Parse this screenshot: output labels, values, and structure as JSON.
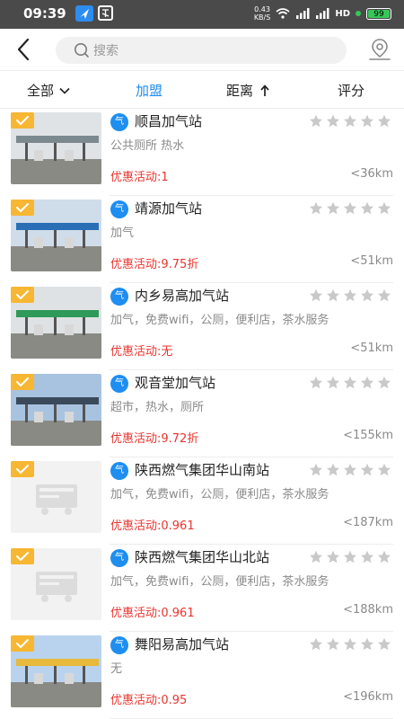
{
  "status_bar": {
    "time": "09:39",
    "net_speed_value": "0.43",
    "net_speed_unit": "KB/S",
    "hd_label": "HD",
    "battery": "99"
  },
  "header": {
    "search_placeholder": "搜索",
    "back_icon": "chevron-left-icon",
    "map_icon": "map-pin-icon"
  },
  "filters": {
    "all": "全部",
    "join": "加盟",
    "distance": "距离",
    "rating": "评分"
  },
  "colors": {
    "accent": "#1e8ef0",
    "promo": "#e8352f",
    "badge": "#f7b733"
  },
  "stations": [
    {
      "name": "顺昌加气站",
      "services": "公共厕所 热水",
      "promo": "优惠活动:1",
      "distance": "<36km",
      "gas_badge": "气",
      "image": "photo"
    },
    {
      "name": "靖源加气站",
      "services": "加气",
      "promo": "优惠活动:9.75折",
      "distance": "<51km",
      "gas_badge": "气",
      "image": "photo"
    },
    {
      "name": "内乡易高加气站",
      "services": "加气，免费wifi，公厕，便利店，茶水服务",
      "promo": "优惠活动:无",
      "distance": "<51km",
      "gas_badge": "气",
      "image": "photo"
    },
    {
      "name": "观音堂加气站",
      "services": "超市，热水，厕所",
      "promo": "优惠活动:9.72折",
      "distance": "<155km",
      "gas_badge": "气",
      "image": "photo"
    },
    {
      "name": "陕西燃气集团华山南站",
      "services": "加气，免费wifi，公厕，便利店，茶水服务",
      "promo": "优惠活动:0.961",
      "distance": "<187km",
      "gas_badge": "气",
      "image": "placeholder"
    },
    {
      "name": "陕西燃气集团华山北站",
      "services": "加气，免费wifi，公厕，便利店，茶水服务",
      "promo": "优惠活动:0.961",
      "distance": "<188km",
      "gas_badge": "气",
      "image": "placeholder"
    },
    {
      "name": "舞阳易高加气站",
      "services": "无",
      "promo": "优惠活动:0.95",
      "distance": "<196km",
      "gas_badge": "气",
      "image": "photo"
    }
  ]
}
